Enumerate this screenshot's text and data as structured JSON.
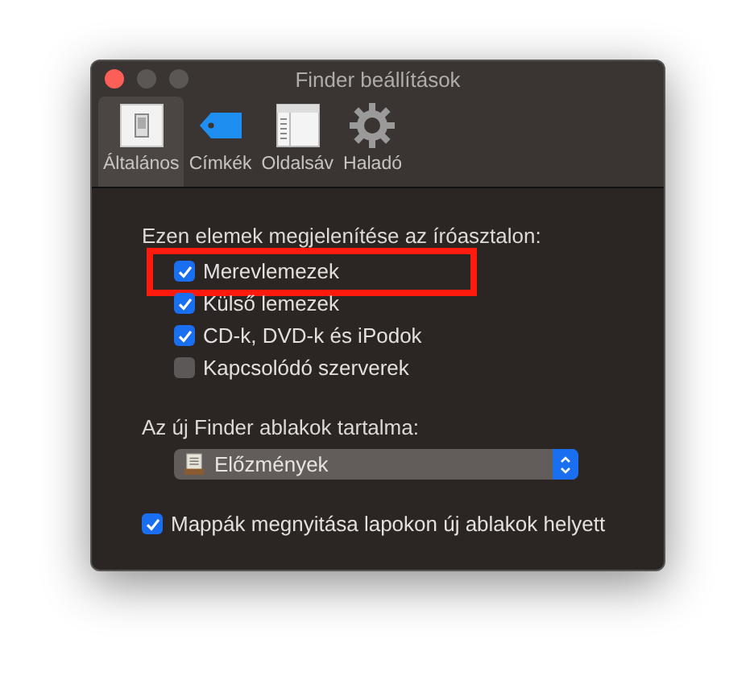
{
  "window": {
    "title": "Finder beállítások"
  },
  "tabs": [
    {
      "label": "Általános",
      "kind": "general",
      "selected": true
    },
    {
      "label": "Címkék",
      "kind": "tags",
      "selected": false
    },
    {
      "label": "Oldalsáv",
      "kind": "sidebar",
      "selected": false
    },
    {
      "label": "Haladó",
      "kind": "advanced",
      "selected": false
    }
  ],
  "desktop_section": {
    "heading": "Ezen elemek megjelenítése az íróasztalon:",
    "items": [
      {
        "label": "Merevlemezek",
        "checked": true,
        "highlighted": true
      },
      {
        "label": "Külső lemezek",
        "checked": true,
        "highlighted": false
      },
      {
        "label": "CD-k, DVD-k és iPodok",
        "checked": true,
        "highlighted": false
      },
      {
        "label": "Kapcsolódó szerverek",
        "checked": false,
        "highlighted": false
      }
    ]
  },
  "new_window": {
    "label": "Az új Finder ablakok tartalma:",
    "value": "Előzmények"
  },
  "tabs_option": {
    "label": "Mappák megnyitása lapokon új ablakok helyett",
    "checked": true
  }
}
